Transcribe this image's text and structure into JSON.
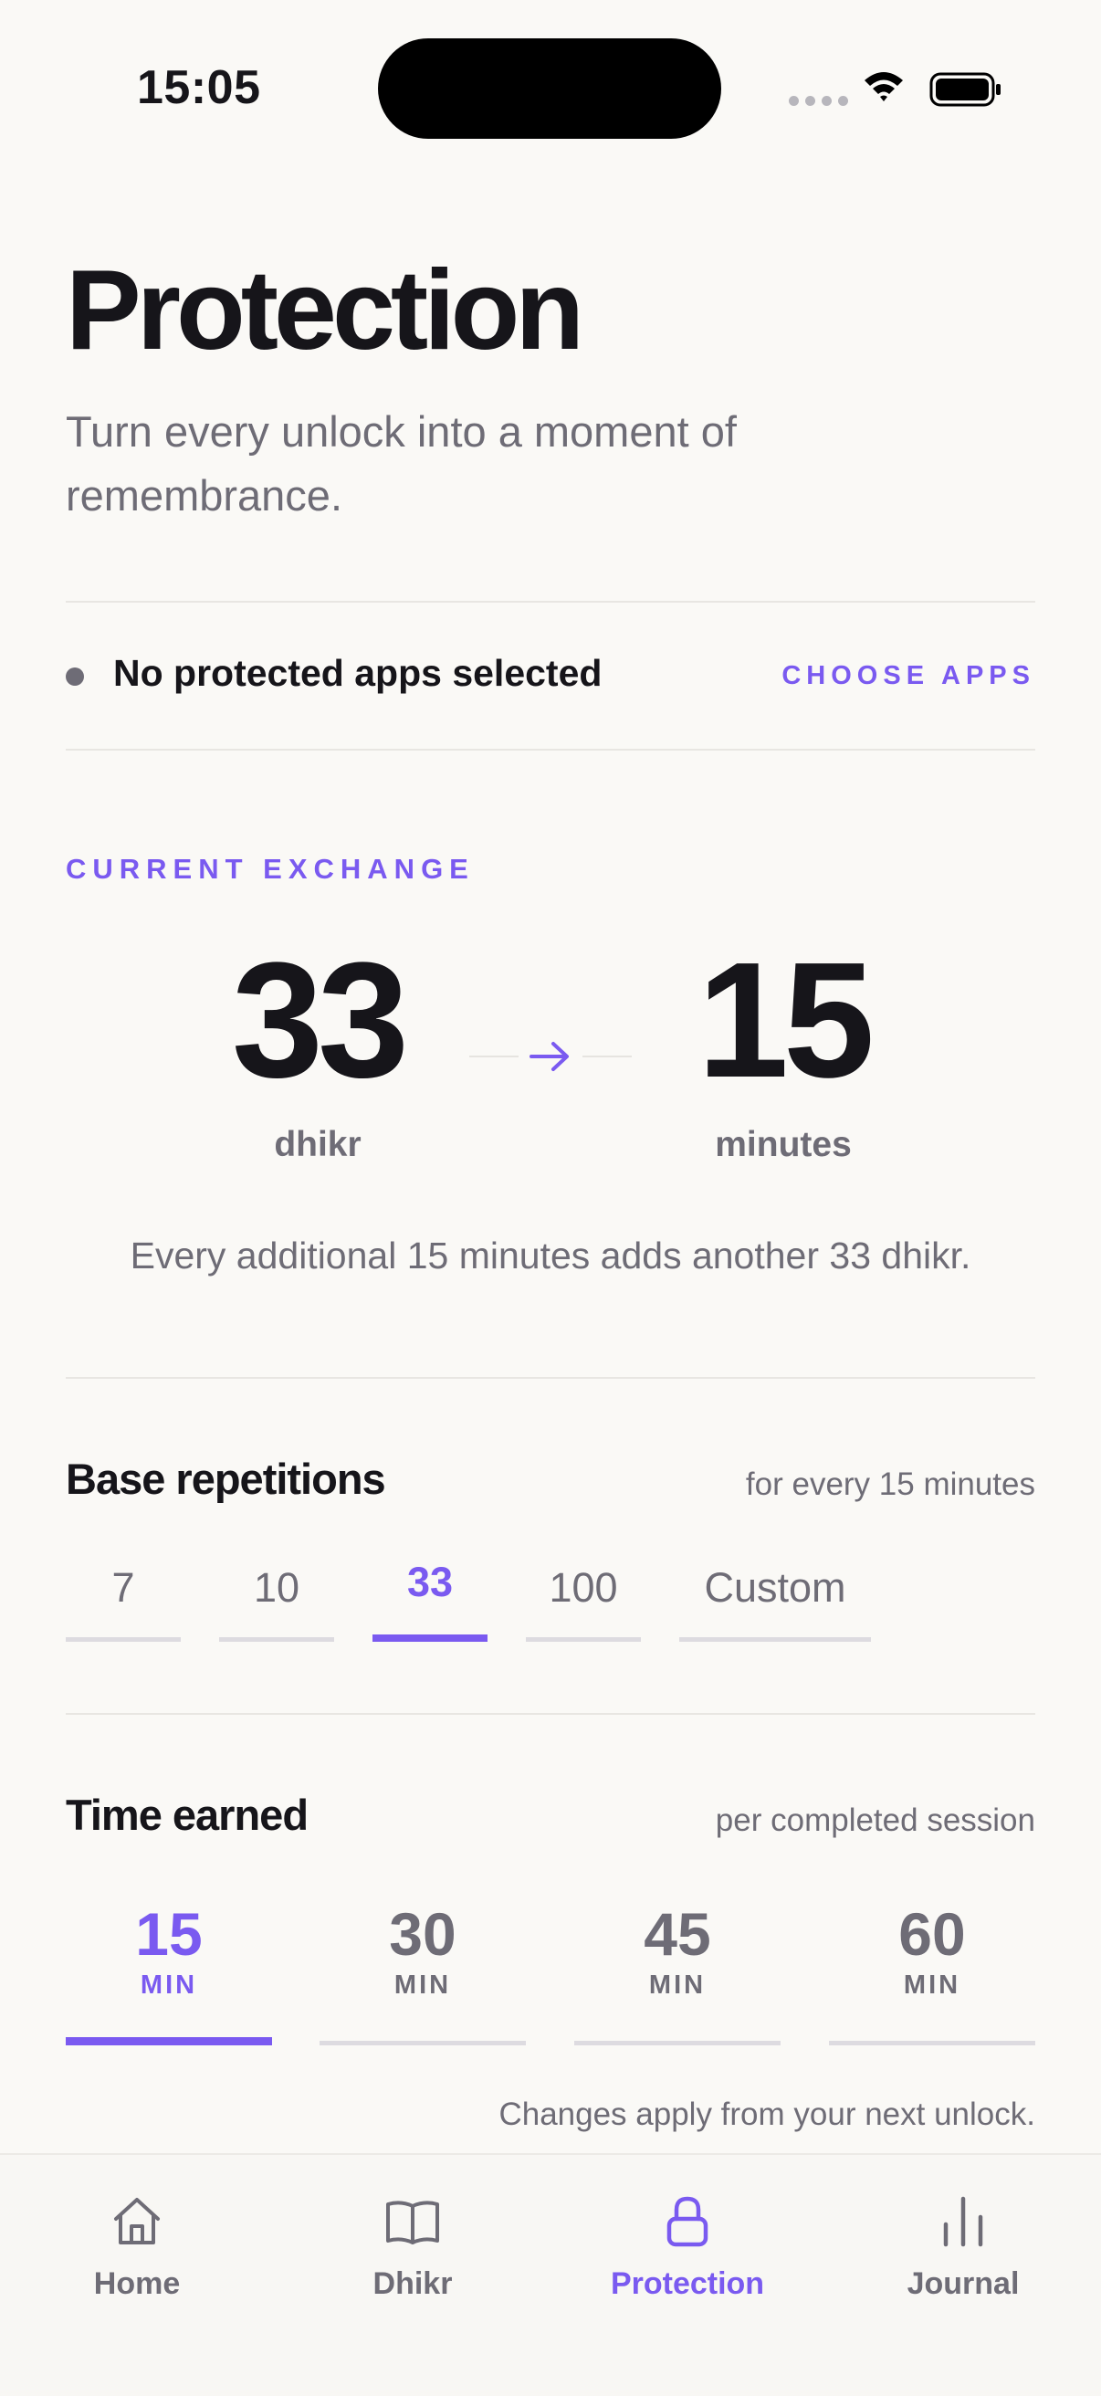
{
  "status_bar": {
    "time": "15:05",
    "icons": [
      "cellular-dots-icon",
      "wifi-icon",
      "battery-icon"
    ]
  },
  "header": {
    "title": "Protection",
    "subtitle": "Turn every unlock into a moment of remembrance."
  },
  "apps": {
    "status": "No protected apps selected",
    "action_label": "CHOOSE APPS"
  },
  "exchange": {
    "label": "CURRENT EXCHANGE",
    "dhikr_count": "33",
    "dhikr_unit": "dhikr",
    "minutes_count": "15",
    "minutes_unit": "minutes",
    "caption": "Every additional 15 minutes adds another 33 dhikr."
  },
  "base_repetitions": {
    "title": "Base repetitions",
    "note": "for every 15 minutes",
    "options": [
      "7",
      "10",
      "33",
      "100",
      "Custom"
    ],
    "selected": "33"
  },
  "time_earned": {
    "title": "Time earned",
    "note": "per completed session",
    "options": [
      {
        "value": "15",
        "unit": "MIN"
      },
      {
        "value": "30",
        "unit": "MIN"
      },
      {
        "value": "45",
        "unit": "MIN"
      },
      {
        "value": "60",
        "unit": "MIN"
      }
    ],
    "selected": "15",
    "apply_note": "Changes apply from your next unlock."
  },
  "tab_bar": {
    "tabs": [
      {
        "label": "Home",
        "icon": "home-icon"
      },
      {
        "label": "Dhikr",
        "icon": "book-icon"
      },
      {
        "label": "Protection",
        "icon": "lock-icon"
      },
      {
        "label": "Journal",
        "icon": "bar-chart-icon"
      }
    ],
    "active": "Protection"
  },
  "colors": {
    "accent": "#7A5AF0",
    "background": "#FAF9F6",
    "text_primary": "#16151A",
    "text_secondary": "#6E6C76",
    "inactive_bar": "#DDDBE0"
  }
}
